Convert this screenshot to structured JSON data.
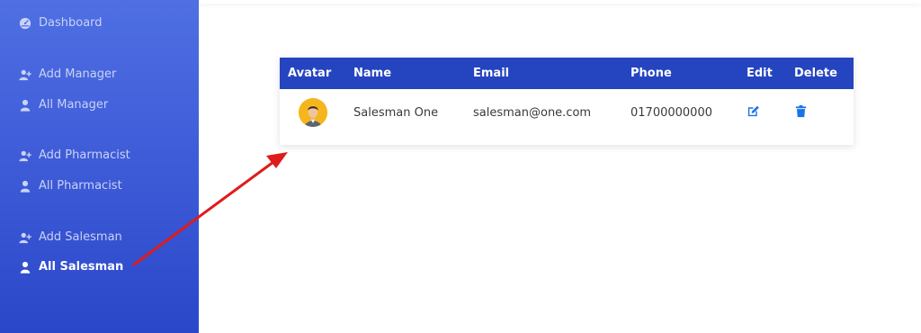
{
  "sidebar": {
    "items": [
      {
        "label": "Dashboard",
        "icon": "dashboard-icon"
      },
      {
        "label": "Add Manager",
        "icon": "user-plus-icon"
      },
      {
        "label": "All Manager",
        "icon": "user-icon"
      },
      {
        "label": "Add Pharmacist",
        "icon": "user-plus-icon"
      },
      {
        "label": "All Pharmacist",
        "icon": "user-icon"
      },
      {
        "label": "Add Salesman",
        "icon": "user-plus-icon"
      },
      {
        "label": "All Salesman",
        "icon": "user-icon",
        "active": true
      }
    ]
  },
  "table": {
    "headers": [
      "Avatar",
      "Name",
      "Email",
      "Phone",
      "Edit",
      "Delete"
    ],
    "rows": [
      {
        "name": "Salesman One",
        "email": "salesman@one.com",
        "phone": "01700000000"
      }
    ]
  },
  "colors": {
    "header_bg": "#2544bf",
    "sidebar_top": "#4f6fe3",
    "sidebar_bottom": "#2a47c9",
    "action_icon": "#1a73e8",
    "arrow": "#e01b1b",
    "avatar_bg": "#f5b61d"
  }
}
